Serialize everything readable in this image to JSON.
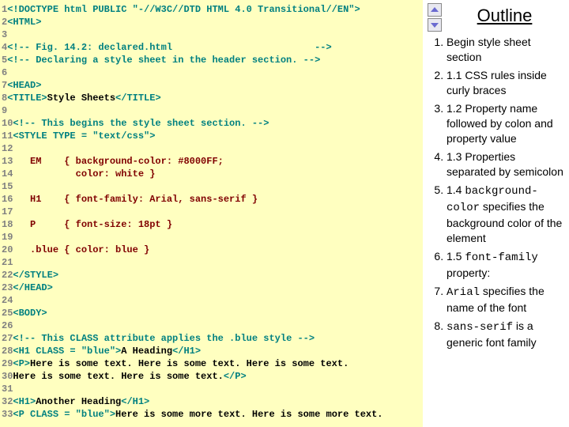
{
  "code": {
    "lines": [
      {
        "n": "1",
        "seg": [
          {
            "c": "tag",
            "t": "<!DOCTYPE html PUBLIC \"-//W3C//DTD HTML 4.0 Transitional//EN\">"
          }
        ]
      },
      {
        "n": "2",
        "seg": [
          {
            "c": "tag",
            "t": "<HTML>"
          }
        ]
      },
      {
        "n": "3",
        "seg": []
      },
      {
        "n": "4",
        "seg": [
          {
            "c": "cmt",
            "t": "<!-- Fig. 14.2: declared.html                         -->"
          }
        ]
      },
      {
        "n": "5",
        "seg": [
          {
            "c": "cmt",
            "t": "<!-- Declaring a style sheet in the header section. -->"
          }
        ]
      },
      {
        "n": "6",
        "seg": []
      },
      {
        "n": "7",
        "seg": [
          {
            "c": "tag",
            "t": "<HEAD>"
          }
        ]
      },
      {
        "n": "8",
        "seg": [
          {
            "c": "tag",
            "t": "<TITLE>"
          },
          {
            "c": "txt",
            "t": "Style Sheets"
          },
          {
            "c": "tag",
            "t": "</TITLE>"
          }
        ]
      },
      {
        "n": "9",
        "seg": []
      },
      {
        "n": "10",
        "seg": [
          {
            "c": "cmt",
            "t": "<!-- This begins the style sheet section. -->"
          }
        ]
      },
      {
        "n": "11",
        "seg": [
          {
            "c": "tag",
            "t": "<STYLE TYPE = "
          },
          {
            "c": "str",
            "t": "\"text/css\""
          },
          {
            "c": "tag",
            "t": ">"
          }
        ]
      },
      {
        "n": "12",
        "seg": []
      },
      {
        "n": "13",
        "seg": [
          {
            "c": "css",
            "t": "   EM    { background-color: #8000FF;"
          }
        ]
      },
      {
        "n": "14",
        "seg": [
          {
            "c": "css",
            "t": "           color: white }"
          }
        ]
      },
      {
        "n": "15",
        "seg": []
      },
      {
        "n": "16",
        "seg": [
          {
            "c": "css",
            "t": "   H1    { font-family: Arial, sans-serif }"
          }
        ]
      },
      {
        "n": "17",
        "seg": []
      },
      {
        "n": "18",
        "seg": [
          {
            "c": "css",
            "t": "   P     { font-size: 18pt }"
          }
        ]
      },
      {
        "n": "19",
        "seg": []
      },
      {
        "n": "20",
        "seg": [
          {
            "c": "css",
            "t": "   .blue { color: blue }"
          }
        ]
      },
      {
        "n": "21",
        "seg": []
      },
      {
        "n": "22",
        "seg": [
          {
            "c": "tag",
            "t": "</STYLE>"
          }
        ]
      },
      {
        "n": "23",
        "seg": [
          {
            "c": "tag",
            "t": "</HEAD>"
          }
        ]
      },
      {
        "n": "24",
        "seg": []
      },
      {
        "n": "25",
        "seg": [
          {
            "c": "tag",
            "t": "<BODY>"
          }
        ]
      },
      {
        "n": "26",
        "seg": []
      },
      {
        "n": "27",
        "seg": [
          {
            "c": "cmt",
            "t": "<!-- This CLASS attribute applies the .blue style -->"
          }
        ]
      },
      {
        "n": "28",
        "seg": [
          {
            "c": "tag",
            "t": "<H1 CLASS = "
          },
          {
            "c": "str",
            "t": "\"blue\""
          },
          {
            "c": "tag",
            "t": ">"
          },
          {
            "c": "txt",
            "t": "A Heading"
          },
          {
            "c": "tag",
            "t": "</H1>"
          }
        ]
      },
      {
        "n": "29",
        "seg": [
          {
            "c": "tag",
            "t": "<P>"
          },
          {
            "c": "txt",
            "t": "Here is some text. Here is some text. Here is some text."
          }
        ]
      },
      {
        "n": "30",
        "seg": [
          {
            "c": "txt",
            "t": "Here is some text. Here is some text."
          },
          {
            "c": "tag",
            "t": "</P>"
          }
        ]
      },
      {
        "n": "31",
        "seg": []
      },
      {
        "n": "32",
        "seg": [
          {
            "c": "tag",
            "t": "<H1>"
          },
          {
            "c": "txt",
            "t": "Another Heading"
          },
          {
            "c": "tag",
            "t": "</H1>"
          }
        ]
      },
      {
        "n": "33",
        "seg": [
          {
            "c": "tag",
            "t": "<P CLASS = "
          },
          {
            "c": "str",
            "t": "\"blue\""
          },
          {
            "c": "tag",
            "t": ">"
          },
          {
            "c": "txt",
            "t": "Here is some more text. Here is some more text."
          }
        ]
      }
    ]
  },
  "outline": {
    "title": "Outline",
    "items": [
      {
        "text": "Begin style sheet section"
      },
      {
        "text": "1.1    CSS rules inside curly braces"
      },
      {
        "text": "1.2    Property name followed by colon and property value"
      },
      {
        "text": "1.3    Properties separated by semicolon"
      },
      {
        "html": "1.4    <span class='of-code'>background-color</span> specifies the background color of the element"
      },
      {
        "html": "1.5    <span class='of-code'>font-family</span> property:"
      },
      {
        "html": "       <span class='of-code'>Arial</span> specifies the name of the font"
      },
      {
        "html": "       <span class='of-code'>sans-serif</span> is a generic font family"
      }
    ]
  }
}
